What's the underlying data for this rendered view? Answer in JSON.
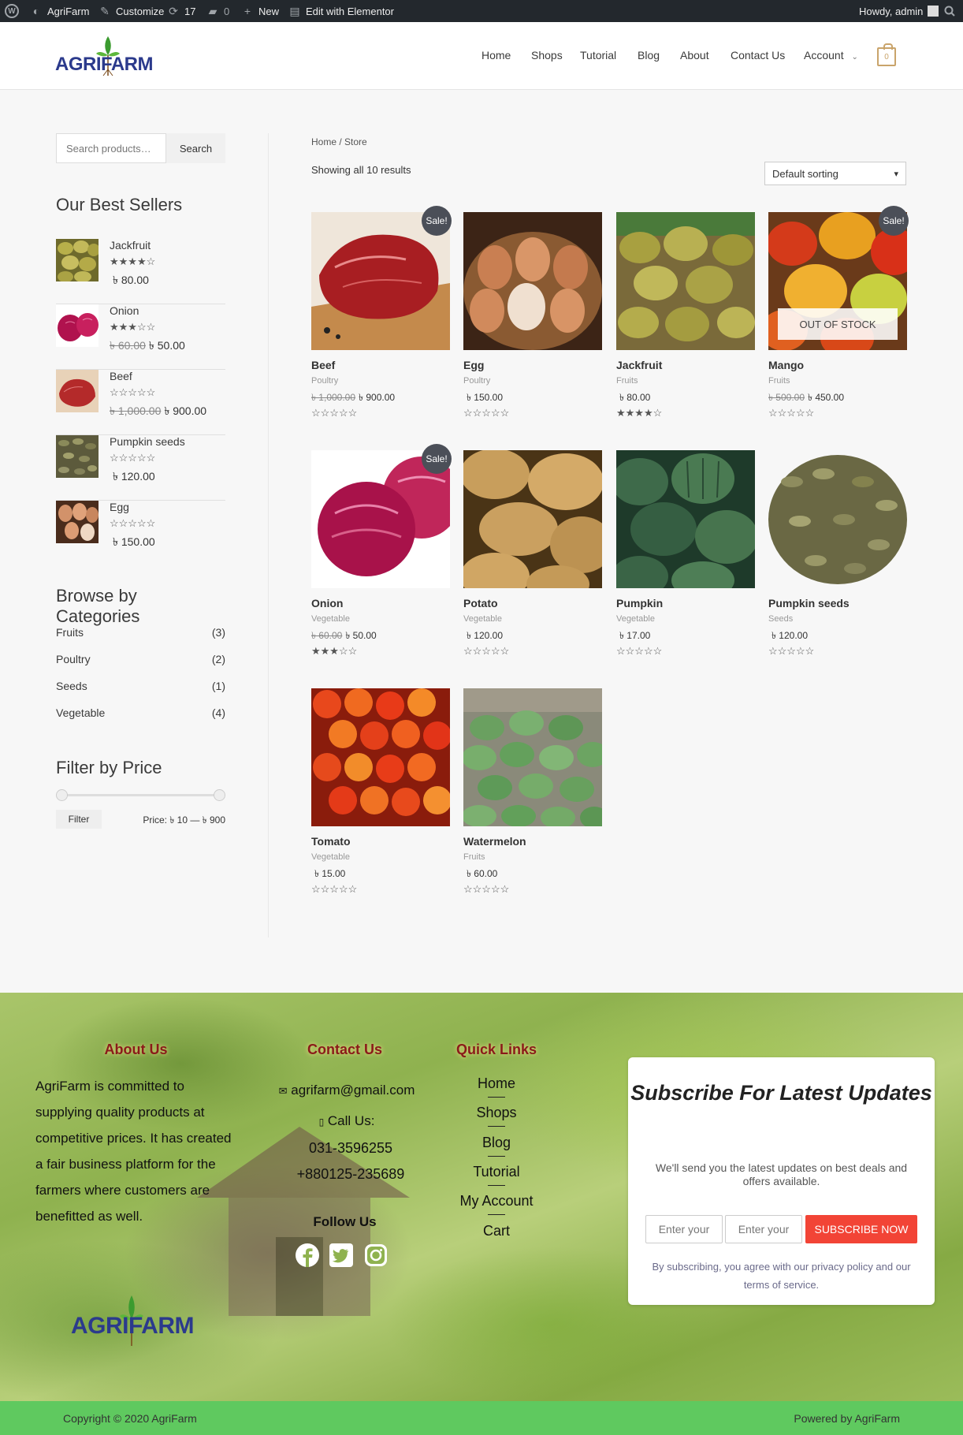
{
  "admin_bar": {
    "site": "AgriFarm",
    "customize": "Customize",
    "updates": "17",
    "comments": "0",
    "new": "New",
    "edit": "Edit with Elementor",
    "howdy": "Howdy, admin"
  },
  "header": {
    "logo_text": "AGRIFARM",
    "nav": [
      "Home",
      "Shops",
      "Tutorial",
      "Blog",
      "About",
      "Contact Us",
      "Account"
    ],
    "cart_count": "0"
  },
  "sidebar": {
    "search_placeholder": "Search products…",
    "search_button": "Search",
    "best_sellers_title": "Our Best Sellers",
    "best_sellers": [
      {
        "name": "Jackfruit",
        "price": "৳ 80.00",
        "old_price": "",
        "rating": 4
      },
      {
        "name": "Onion",
        "price": "৳ 50.00",
        "old_price": "৳ 60.00",
        "rating": 3
      },
      {
        "name": "Beef",
        "price": "৳ 900.00",
        "old_price": "৳ 1,000.00",
        "rating": 0
      },
      {
        "name": "Pumpkin seeds",
        "price": "৳ 120.00",
        "old_price": "",
        "rating": 0
      },
      {
        "name": "Egg",
        "price": "৳ 150.00",
        "old_price": "",
        "rating": 0
      }
    ],
    "categories_title": "Browse by Categories",
    "categories": [
      {
        "name": "Fruits",
        "count": "(3)"
      },
      {
        "name": "Poultry",
        "count": "(2)"
      },
      {
        "name": "Seeds",
        "count": "(1)"
      },
      {
        "name": "Vegetable",
        "count": "(4)"
      }
    ],
    "filter_title": "Filter by Price",
    "filter_button": "Filter",
    "price_range": "Price: ৳ 10 — ৳ 900"
  },
  "main": {
    "breadcrumb": "Home / Store",
    "result_count": "Showing all 10 results",
    "sort_selected": "Default sorting",
    "sale_badge": "Sale!",
    "out_of_stock": "OUT OF STOCK",
    "products": [
      {
        "name": "Beef",
        "category": "Poultry",
        "price": "৳ 900.00",
        "old_price": "৳ 1,000.00",
        "rating": 0,
        "sale": true,
        "oos": false
      },
      {
        "name": "Egg",
        "category": "Poultry",
        "price": "৳ 150.00",
        "old_price": "",
        "rating": 0,
        "sale": false,
        "oos": false
      },
      {
        "name": "Jackfruit",
        "category": "Fruits",
        "price": "৳ 80.00",
        "old_price": "",
        "rating": 4,
        "sale": false,
        "oos": false
      },
      {
        "name": "Mango",
        "category": "Fruits",
        "price": "৳ 450.00",
        "old_price": "৳ 500.00",
        "rating": 0,
        "sale": true,
        "oos": true
      },
      {
        "name": "Onion",
        "category": "Vegetable",
        "price": "৳ 50.00",
        "old_price": "৳ 60.00",
        "rating": 3,
        "sale": true,
        "oos": false
      },
      {
        "name": "Potato",
        "category": "Vegetable",
        "price": "৳ 120.00",
        "old_price": "",
        "rating": 0,
        "sale": false,
        "oos": false
      },
      {
        "name": "Pumpkin",
        "category": "Vegetable",
        "price": "৳ 17.00",
        "old_price": "",
        "rating": 0,
        "sale": false,
        "oos": false
      },
      {
        "name": "Pumpkin seeds",
        "category": "Seeds",
        "price": "৳ 120.00",
        "old_price": "",
        "rating": 0,
        "sale": false,
        "oos": false
      },
      {
        "name": "Tomato",
        "category": "Vegetable",
        "price": "৳ 15.00",
        "old_price": "",
        "rating": 0,
        "sale": false,
        "oos": false
      },
      {
        "name": "Watermelon",
        "category": "Fruits",
        "price": "৳ 60.00",
        "old_price": "",
        "rating": 0,
        "sale": false,
        "oos": false
      }
    ]
  },
  "footer": {
    "about_title": "About Us",
    "about_text": "AgriFarm is committed to supplying quality products at competitive prices. It has created a fair business platform for the farmers where customers are benefitted as well.",
    "contact_title": "Contact Us",
    "email": "agrifarm@gmail.com",
    "call_label": "Call Us:",
    "phone1": "031-3596255",
    "phone2": "+880125-235689",
    "follow_title": "Follow Us",
    "quick_title": "Quick Links",
    "quick_links": [
      "Home",
      "Shops",
      "Blog",
      "Tutorial",
      "My Account",
      "Cart"
    ],
    "subscribe_title": "Subscribe For Latest Updates",
    "subscribe_desc": "We'll send you the latest updates on best deals and offers available.",
    "input1_placeholder": "Enter your",
    "input2_placeholder": "Enter your",
    "subscribe_button": "SUBSCRIBE NOW",
    "subscribe_terms": "By subscribing, you agree with our privacy policy and our terms of service."
  },
  "copyright": {
    "left": "Copyright © 2020 AgriFarm",
    "right": "Powered by AgriFarm"
  }
}
